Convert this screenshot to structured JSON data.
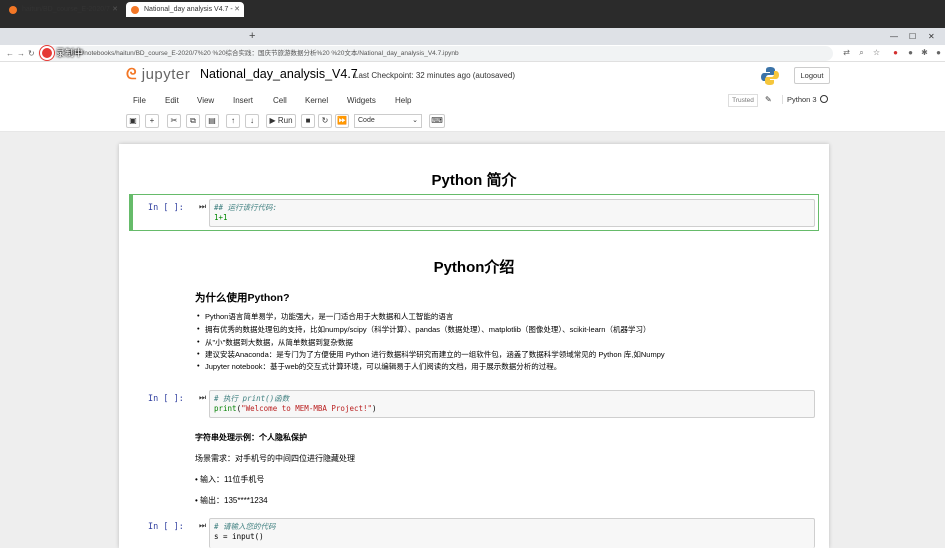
{
  "browser": {
    "tabs": [
      {
        "title": "haitun/BD_course_E-2020/7",
        "active": false
      },
      {
        "title": "National_day analysis V4.7 -",
        "active": true
      }
    ],
    "new_tab": "+",
    "url": "8888/notebooks/haitun/BD_course_E-2020/7%20 %20综合实践：国庆节旅游数据分析%20 %20文本/National_day_analysis_V4.7.ipynb",
    "recording_label": "录制中"
  },
  "jupyter": {
    "logo_text": "jupyter",
    "notebook_name": "National_day_analysis_V4.7",
    "checkpoint": "Last Checkpoint: 32 minutes ago  (autosaved)",
    "logout": "Logout",
    "menu": [
      "File",
      "Edit",
      "View",
      "Insert",
      "Cell",
      "Kernel",
      "Widgets",
      "Help"
    ],
    "trusted": "Trusted",
    "kernel": "Python 3",
    "toolbar": {
      "run": "▶ Run",
      "cell_type": "Code"
    }
  },
  "cells": {
    "heading1": "Python 简介",
    "cell1": {
      "prompt": "In [ ]:",
      "comment": "## 运行该行代码:",
      "code": "1+1"
    },
    "heading2": "Python介绍",
    "why_title": "为什么使用Python?",
    "bullets": [
      "Python语言简单易学，功能强大，是一门适合用于大数据和人工智能的语言",
      "拥有优秀的数据处理包的支持，比如numpy/scipy（科学计算）、pandas（数据处理）、matplotlib（图像处理）、scikit-learn（机器学习）",
      "从\"小\"数据到大数据，从简单数据到复杂数据",
      "建议安装Anaconda：是专门为了方便使用 Python 进行数据科学研究而建立的一组软件包，涵盖了数据科学领域常见的 Python 库,如Numpy",
      "Jupyter notebook：基于web的交互式计算环境，可以编辑易于人们阅读的文档，用于展示数据分析的过程。"
    ],
    "cell2": {
      "prompt": "In [ ]:",
      "comment": "# 执行 print()函数",
      "code_fn": "print",
      "code_str": "\"Welcome to MEM-MBA Project!\""
    },
    "string_title": "字符串处理示例：个人隐私保护",
    "scenario": "场景需求：对手机号的中间四位进行隐藏处理",
    "input_line": "• 输入：11位手机号",
    "output_line": "• 输出：135****1234",
    "cell3": {
      "prompt": "In [ ]:",
      "comment": "# 请输入您的代码",
      "code": "s = input()"
    }
  }
}
